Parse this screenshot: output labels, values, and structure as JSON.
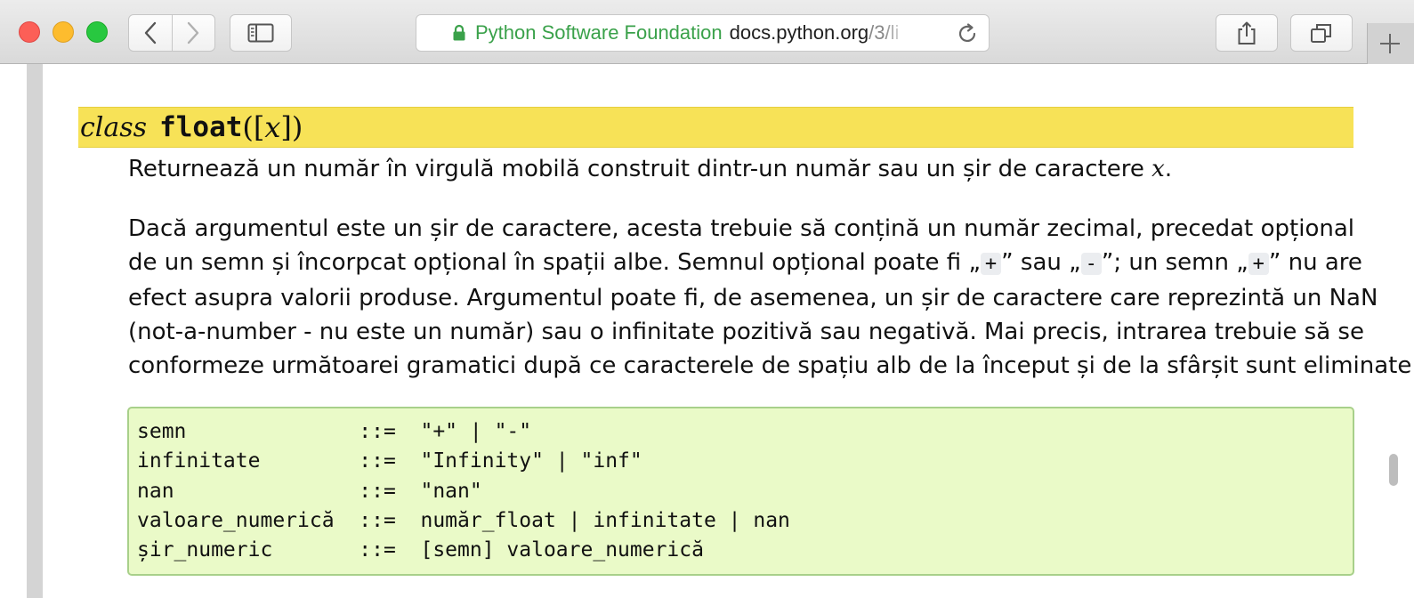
{
  "browser": {
    "address": {
      "org_name": "Python Software Foundation",
      "domain": "docs.python.org",
      "path": "/3/li"
    }
  },
  "doc": {
    "signature": {
      "keyword": "class",
      "name": "float",
      "open": "([",
      "arg": "x",
      "close": "])"
    },
    "intro": {
      "text": "Returnează un număr în virgulă mobilă construit dintr-un număr sau un șir de caractere ",
      "var": "x",
      "end": "."
    },
    "description": {
      "line1": "Dacă argumentul este un șir de caractere, acesta trebuie să conțină un număr zecimal, precedat opțional",
      "line2_a": "de un semn și încorpcat opțional în spații albe. Semnul opțional poate fi „",
      "plus_1": "+",
      "line2_b": "” sau „",
      "minus": "-",
      "line2_c": "”; un semn „",
      "plus_2": "+",
      "line2_d": "” nu are",
      "line3": "efect asupra valorii produse. Argumentul poate fi, de asemenea, un șir de caractere care reprezintă un NaN",
      "line4": "(not-a-number - nu este un număr) sau o infinitate pozitivă sau negativă. Mai precis, intrarea trebuie să se",
      "line5": "conformeze următoarei gramatici după ce caracterele de spațiu alb de la început și de la sfârșit sunt eliminate:"
    },
    "grammar": [
      "semn              ::=  \"+\" | \"-\"",
      "infinitate        ::=  \"Infinity\" | \"inf\"",
      "nan               ::=  \"nan\"",
      "valoare_numerică  ::=  număr_float | infinitate | nan",
      "șir_numeric       ::=  [semn] valoare_numerică"
    ]
  }
}
